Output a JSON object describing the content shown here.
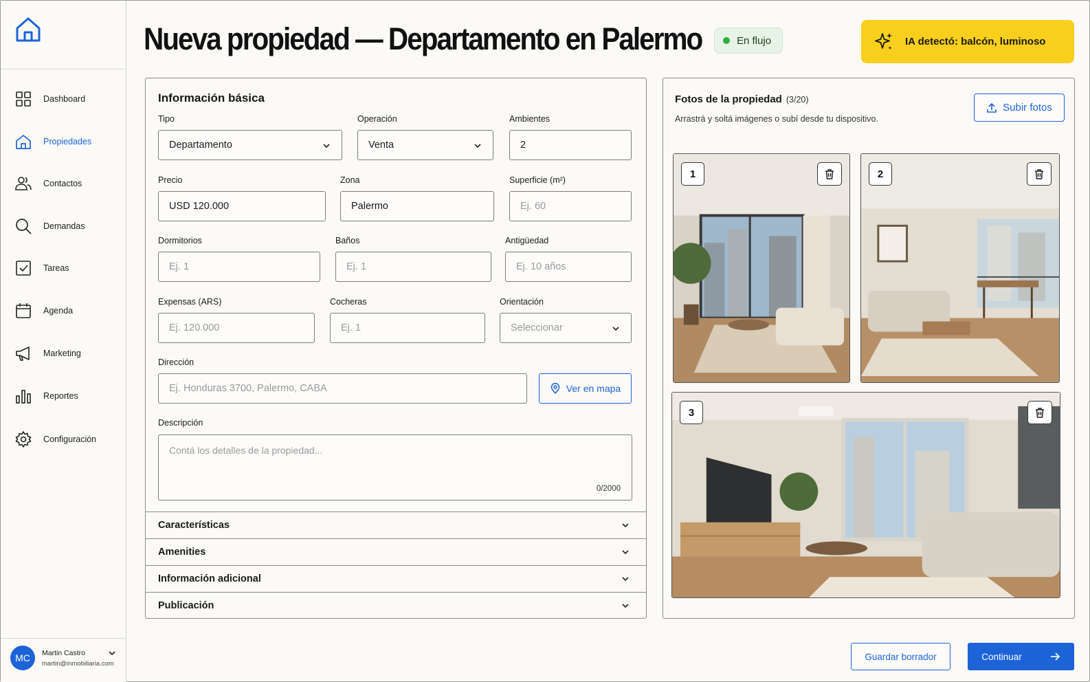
{
  "header": {
    "title": "Nueva propiedad — Departamento en Palermo",
    "status": "En flujo",
    "ai_banner": "IA detectó: balcón, luminoso"
  },
  "sidebar": {
    "items": [
      {
        "label": "Dashboard",
        "icon": "grid-icon",
        "active": false
      },
      {
        "label": "Propiedades",
        "icon": "house-icon",
        "active": true
      },
      {
        "label": "Contactos",
        "icon": "users-icon",
        "active": false
      },
      {
        "label": "Demandas",
        "icon": "search-icon",
        "active": false
      },
      {
        "label": "Tareas",
        "icon": "checkbox-icon",
        "active": false
      },
      {
        "label": "Agenda",
        "icon": "calendar-icon",
        "active": false
      },
      {
        "label": "Marketing",
        "icon": "megaphone-icon",
        "active": false
      },
      {
        "label": "Reportes",
        "icon": "bar-chart-icon",
        "active": false
      },
      {
        "label": "Configuración",
        "icon": "gear-icon",
        "active": false
      }
    ],
    "user": {
      "initials": "MC",
      "name": "Martin Castro",
      "email": "martin@inmobiliaria.com"
    }
  },
  "form": {
    "section_title": "Información básica",
    "tipo": {
      "label": "Tipo",
      "value": "Departamento"
    },
    "operacion": {
      "label": "Operación",
      "value": "Venta"
    },
    "ambientes": {
      "label": "Ambientes",
      "value": "2"
    },
    "precio": {
      "label": "Precio",
      "value": "USD 120.000"
    },
    "zona": {
      "label": "Zona",
      "value": "Palermo"
    },
    "superficie": {
      "label": "Superficie (m²)",
      "placeholder": "Ej. 60"
    },
    "dormitorios": {
      "label": "Dormitorios",
      "placeholder": "Ej. 1"
    },
    "banos": {
      "label": "Baños",
      "placeholder": "Ej. 1"
    },
    "antiguedad": {
      "label": "Antigüedad",
      "placeholder": "Ej. 10 años"
    },
    "expensas": {
      "label": "Expensas (ARS)",
      "placeholder": "Ej. 120.000"
    },
    "cocheras": {
      "label": "Cocheras",
      "placeholder": "Ej. 1"
    },
    "orientacion": {
      "label": "Orientación",
      "placeholder": "Seleccionar"
    },
    "direccion": {
      "label": "Dirección",
      "placeholder": "Ej. Honduras 3700, Palermo, CABA",
      "map_button": "Ver en mapa"
    },
    "descripcion": {
      "label": "Descripción",
      "placeholder": "Contá los detalles de la propiedad...",
      "counter": "0/2000"
    },
    "accordions": [
      "Características",
      "Amenities",
      "Información adicional",
      "Publicación"
    ]
  },
  "photos": {
    "title": "Fotos de la propiedad",
    "count": "(3/20)",
    "hint": "Arrastrá y soltá imágenes o subí desde tu dispositivo.",
    "upload_label": "Subir fotos",
    "items": [
      {
        "number": "1"
      },
      {
        "number": "2"
      },
      {
        "number": "3"
      }
    ]
  },
  "footer": {
    "draft_label": "Guardar borrador",
    "continue_label": "Continuar"
  },
  "colors": {
    "accent": "#1d63d8",
    "ai_banner": "#f8cf1c",
    "status_bg": "#e7f3e6",
    "status_dot": "#2fae3f"
  }
}
